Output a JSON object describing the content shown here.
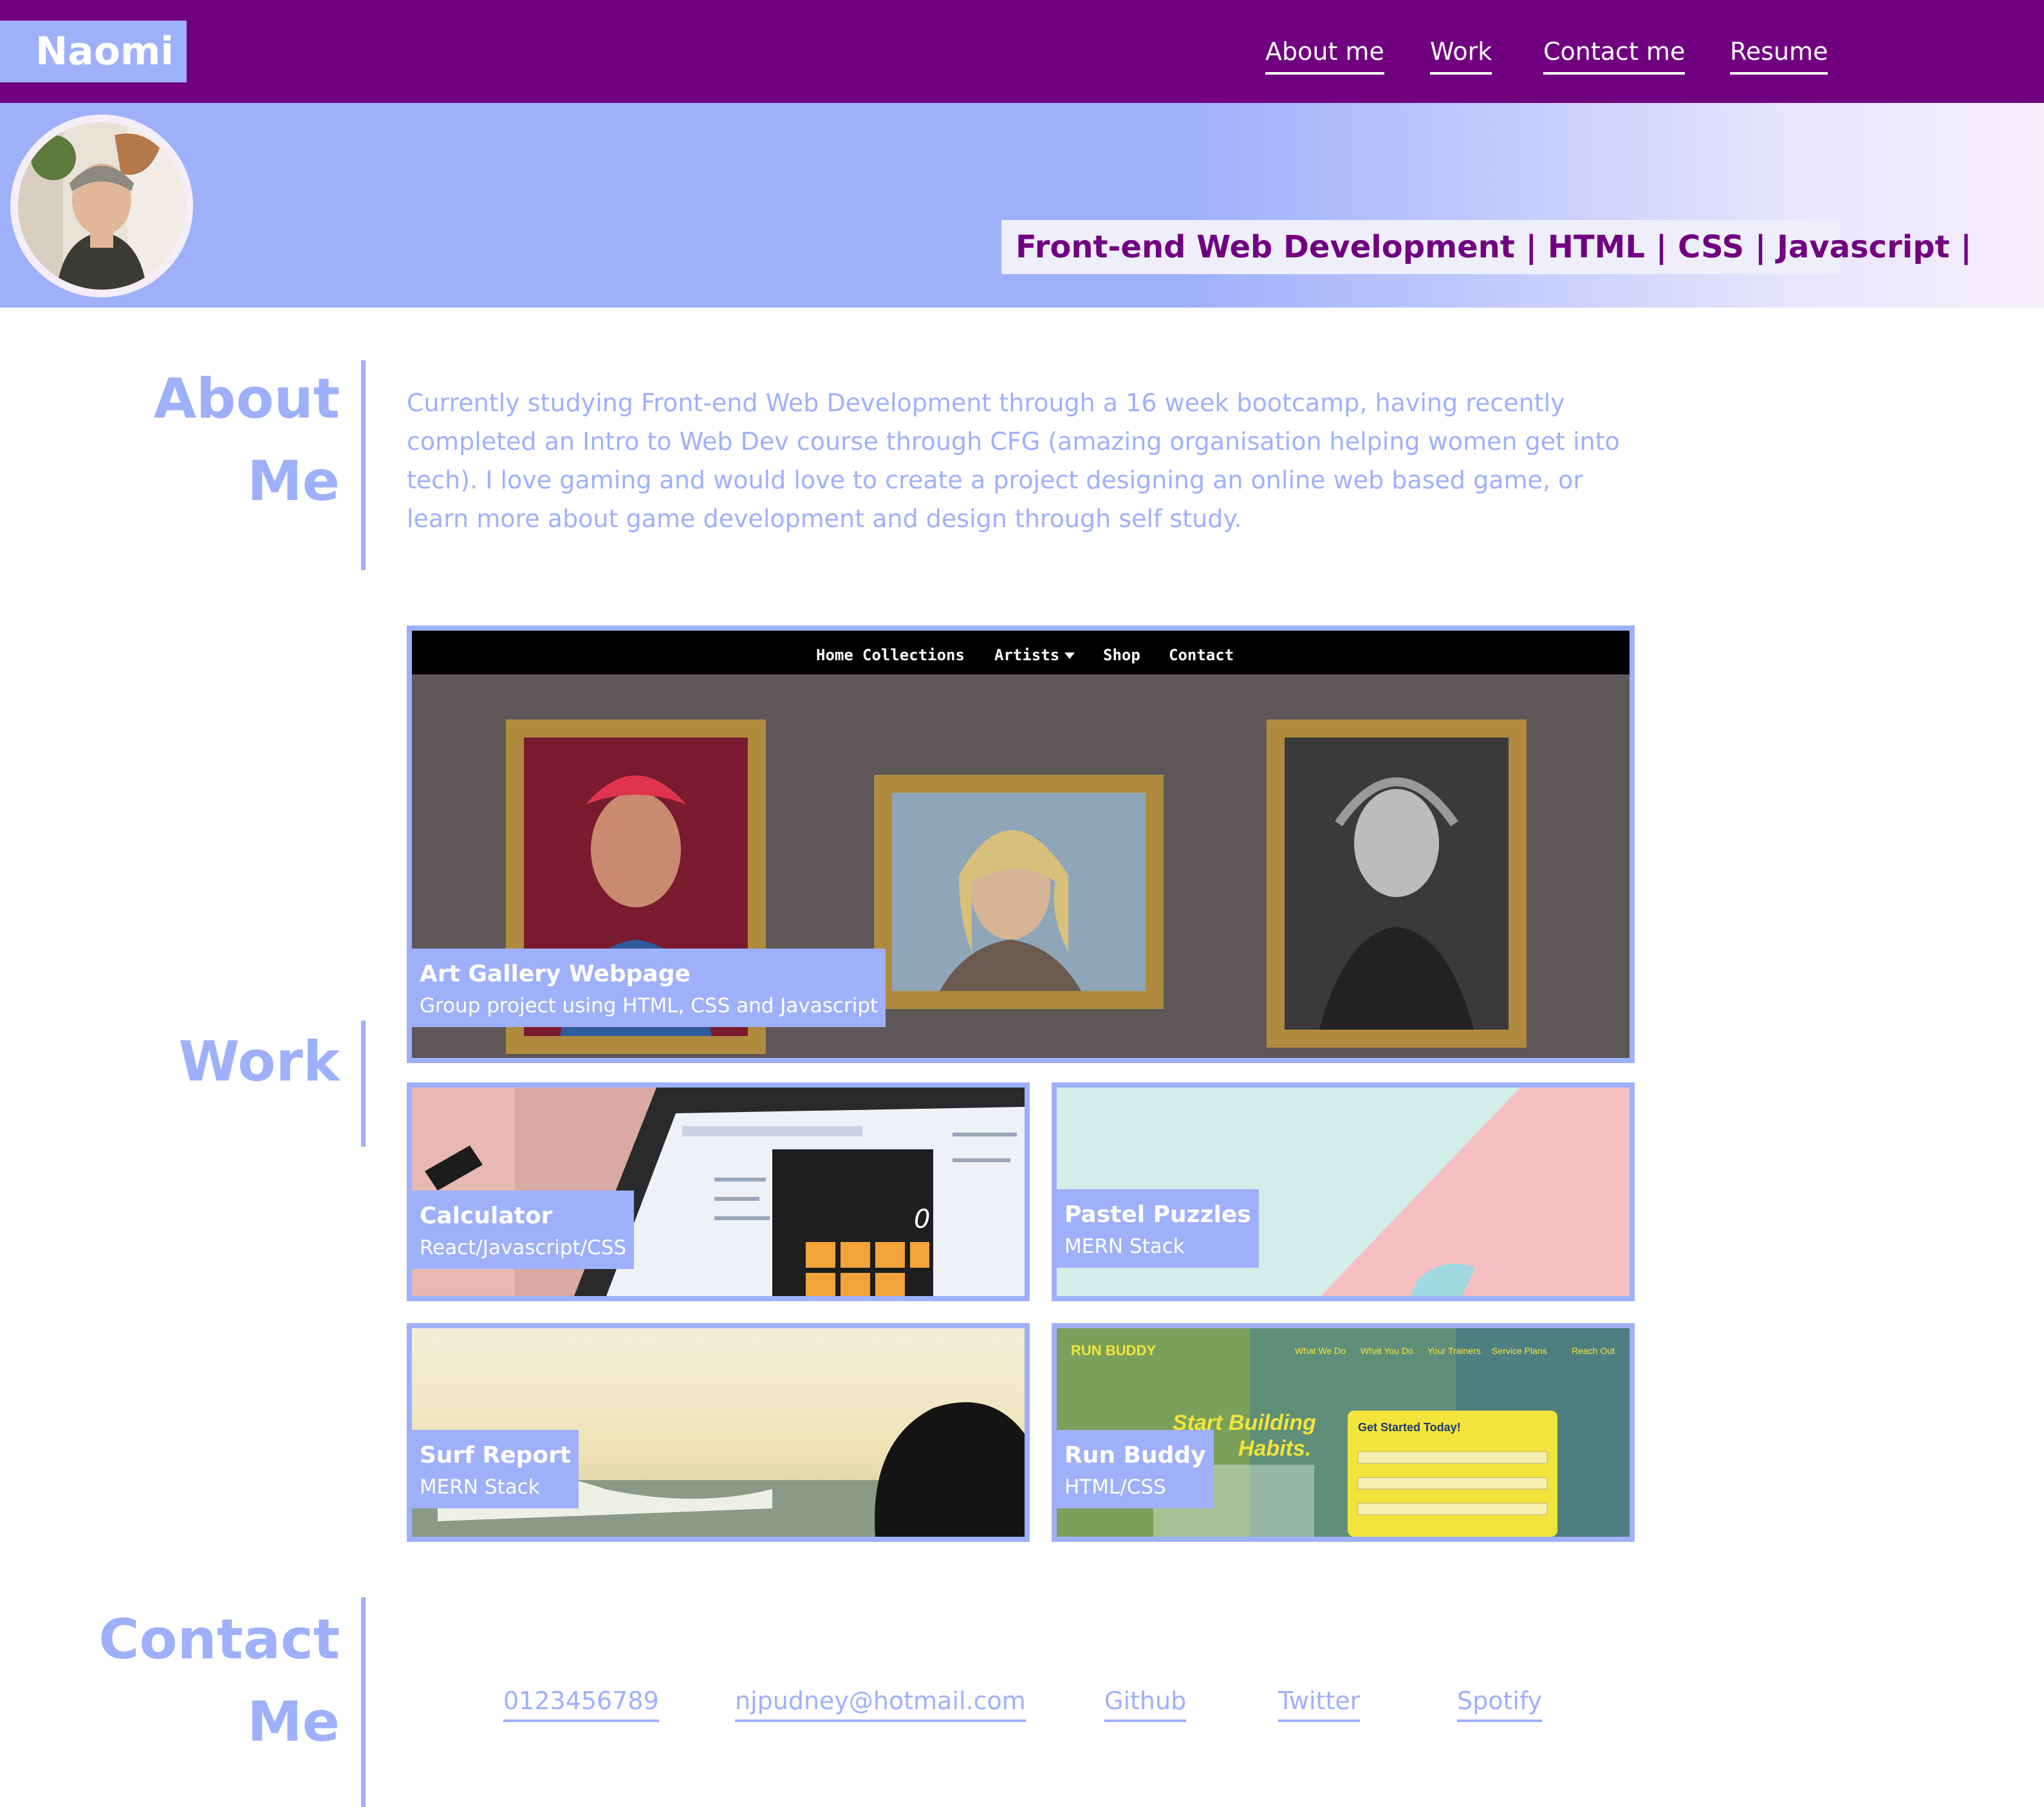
{
  "header": {
    "brand": "Naomi",
    "nav": [
      {
        "label": "About me"
      },
      {
        "label": "Work"
      },
      {
        "label": "Contact me"
      },
      {
        "label": "Resume"
      }
    ],
    "tagline": "Front-end Web Development | HTML | CSS | Javascript |"
  },
  "about": {
    "title_line1": "About",
    "title_line2": "Me",
    "text": "Currently studying Front-end Web Development through a 16 week bootcamp, having recently completed an Intro to Web Dev course through CFG (amazing organisation helping women get into tech). I love gaming and would love to create a project designing an online web based game, or learn more about game development and design through self study."
  },
  "work": {
    "title": "Work",
    "featured": {
      "title": "Art Gallery Webpage",
      "subtitle": "Group project using HTML, CSS and Javascript",
      "screenshot_nav": [
        "Home",
        "Collections",
        "Artists",
        "Shop",
        "Contact"
      ]
    },
    "projects": [
      {
        "title": "Calculator",
        "subtitle": "React/Javascript/CSS",
        "calc_display": "0"
      },
      {
        "title": "Pastel Puzzles",
        "subtitle": "MERN Stack"
      },
      {
        "title": "Surf Report",
        "subtitle": "MERN Stack"
      },
      {
        "title": "Run Buddy",
        "subtitle": "HTML/CSS",
        "screenshot": {
          "brand": "RUN BUDDY",
          "nav": [
            "What We Do",
            "What You Do",
            "Your Trainers",
            "Service Plans",
            "Reach Out"
          ],
          "headline_1": "Start Building",
          "headline_2": "Habits.",
          "form_title": "Get Started Today!"
        }
      }
    ]
  },
  "contact": {
    "title_line1": "Contact",
    "title_line2": "Me",
    "links": [
      {
        "label": "0123456789"
      },
      {
        "label": "njpudney@hotmail.com"
      },
      {
        "label": "Github"
      },
      {
        "label": "Twitter"
      },
      {
        "label": "Spotify"
      }
    ]
  },
  "colors": {
    "brand_purple": "#710081",
    "periwinkle": "#9fb0fb",
    "white": "#ffffff"
  }
}
